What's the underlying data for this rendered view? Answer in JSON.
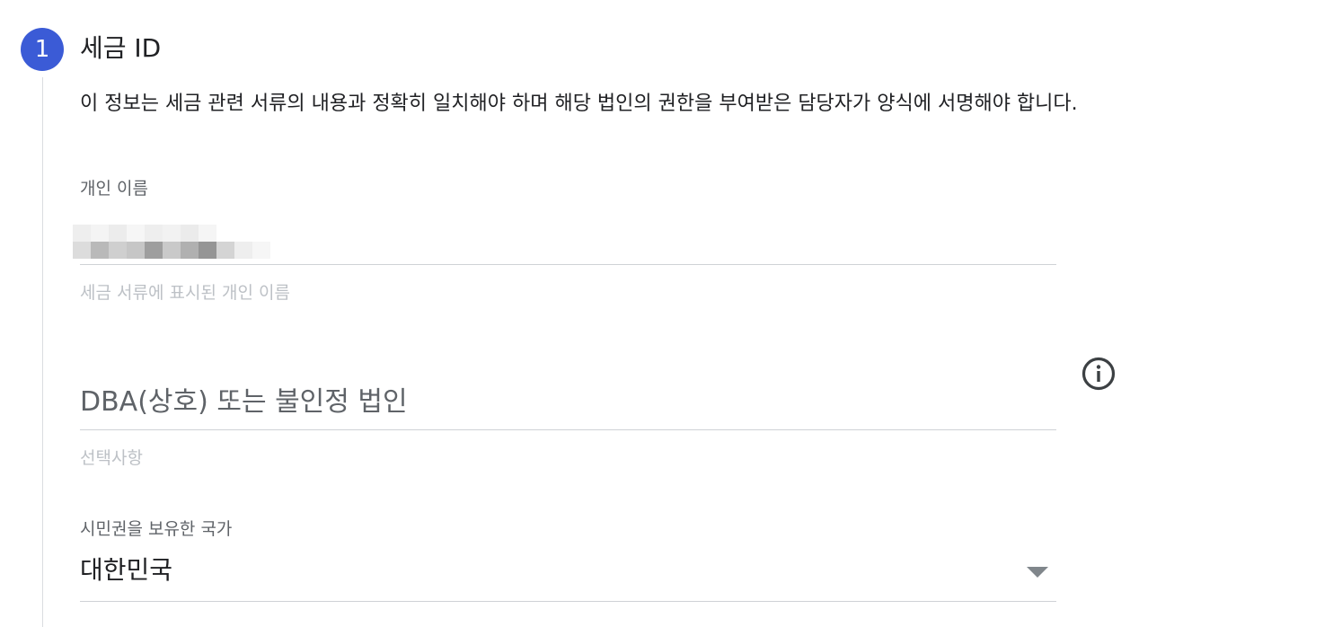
{
  "step": {
    "number": "1",
    "title": "세금 ID",
    "color": "#3b5bd6"
  },
  "description": "이 정보는 세금 관련 서류의 내용과 정확히 일치해야 하며 해당 법인의 권한을 부여받은 담당자가 양식에 서명해야 합니다.",
  "fields": {
    "individual_name": {
      "label": "개인 이름",
      "value_redacted": true,
      "helper": "세금 서류에 표시된 개인 이름"
    },
    "dba": {
      "placeholder": "DBA(상호) 또는 불인정 법인",
      "helper": "선택사항",
      "info_icon": "info-icon"
    },
    "citizenship_country": {
      "label": "시민권을 보유한 국가",
      "selected": "대한민국",
      "icon": "dropdown-arrow-icon"
    }
  }
}
